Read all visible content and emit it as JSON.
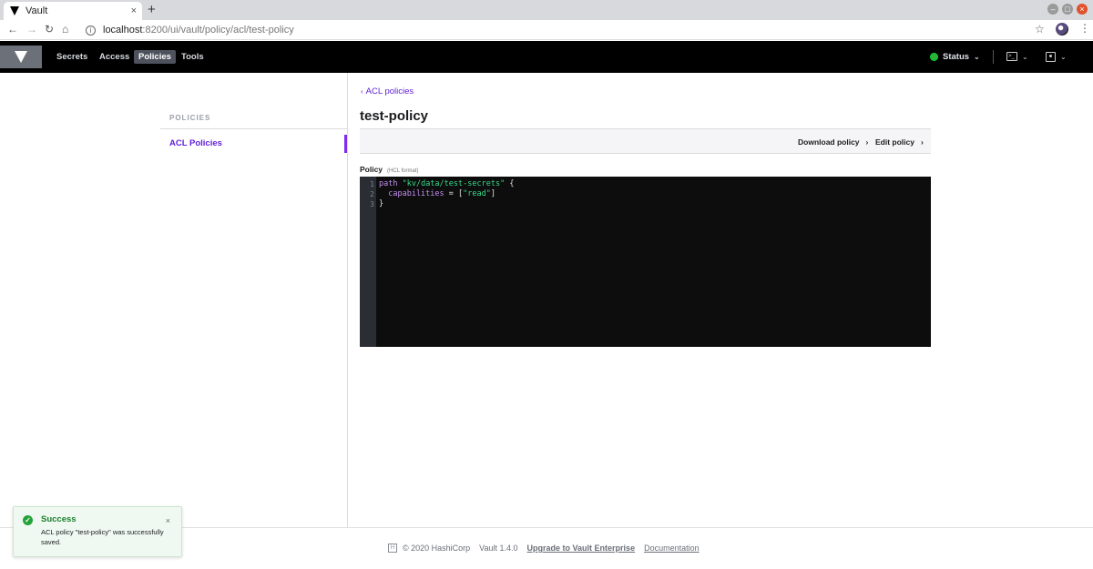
{
  "browser": {
    "tab_title": "Vault",
    "tab_close": "×",
    "new_tab": "+",
    "url_host": "localhost",
    "url_path": ":8200/ui/vault/policy/acl/test-policy"
  },
  "nav": {
    "items": [
      "Secrets",
      "Access",
      "Policies",
      "Tools"
    ],
    "active": "Policies",
    "status_label": "Status",
    "status_color": "#2eb039"
  },
  "sidebar": {
    "heading": "POLICIES",
    "items": [
      {
        "label": "ACL Policies",
        "active": true
      }
    ]
  },
  "main": {
    "breadcrumb": "ACL policies",
    "title": "test-policy",
    "actions": {
      "download": "Download policy",
      "edit": "Edit policy"
    },
    "policy_label": "Policy",
    "policy_hint": "(HCL format)",
    "code": {
      "line_numbers": [
        "1",
        "2",
        "3"
      ],
      "line1_kw": "path",
      "line1_str": "\"kv/data/test-secrets\"",
      "line1_rest": " {",
      "line2_kw": "  capabilities",
      "line2_mid": " = [",
      "line2_str": "\"read\"",
      "line2_end": "]",
      "line3": "}"
    }
  },
  "footer": {
    "copyright": "© 2020 HashiCorp",
    "version": "Vault 1.4.0",
    "upgrade": "Upgrade to Vault Enterprise",
    "docs": "Documentation"
  },
  "toast": {
    "title": "Success",
    "message": "ACL policy \"test-policy\" was successfully saved.",
    "close": "×"
  },
  "colors": {
    "accent": "#5f1ed8",
    "nav_bg": "#000000",
    "editor_bg": "#0d0d0d",
    "success": "#1a7f2c"
  }
}
